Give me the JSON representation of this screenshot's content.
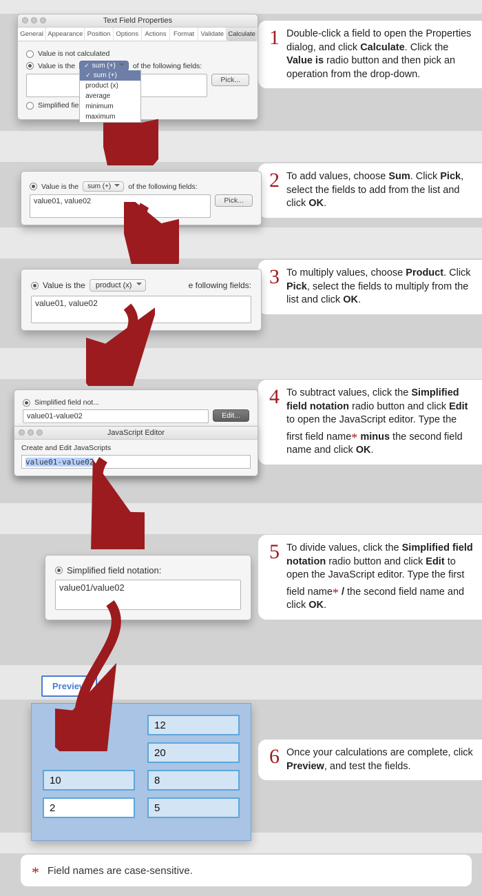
{
  "dialog": {
    "title": "Text Field Properties",
    "tabs": [
      "General",
      "Appearance",
      "Position",
      "Options",
      "Actions",
      "Format",
      "Validate",
      "Calculate"
    ],
    "active_tab": "Calculate",
    "radio_not_calc": "Value is not calculated",
    "value_is_the": "Value is the",
    "of_following": "of the following fields:",
    "simplified_label": "Simplified field notation:",
    "pick": "Pick...",
    "edit": "Edit...",
    "dd_options": [
      "sum (+)",
      "product (x)",
      "average",
      "minimum",
      "maximum"
    ]
  },
  "panel1": {
    "selected_option": "sum (+)"
  },
  "panel2": {
    "selected_option": "sum (+)",
    "fields": "value01, value02"
  },
  "panel3": {
    "selected_option": "product (x)",
    "fields": "value01, value02"
  },
  "panel4": {
    "radio": "Simplified field not...",
    "value": "value01-value02",
    "js_title": "JavaScript Editor",
    "js_label": "Create and Edit JavaScripts",
    "js_code": "value01-value02"
  },
  "panel5": {
    "label": "Simplified field notation:",
    "value": "value01/value02"
  },
  "preview": {
    "btn": "Preview",
    "left": [
      "10",
      "2"
    ],
    "right": [
      "12",
      "20",
      "8",
      "5"
    ]
  },
  "steps": {
    "s1": {
      "n": "1",
      "parts": [
        "Double-click a field to open the Properties dialog, and click ",
        {
          "b": "Calculate"
        },
        ". Click the ",
        {
          "b": "Value is"
        },
        " radio button and then pick an operation from the drop-down."
      ]
    },
    "s2": {
      "n": "2",
      "parts": [
        "To add values, choose ",
        {
          "b": "Sum"
        },
        ". Click ",
        {
          "b": "Pick"
        },
        ", select the fields to add from the list and click ",
        {
          "b": "OK"
        },
        "."
      ]
    },
    "s3": {
      "n": "3",
      "parts": [
        "To multiply values, choose ",
        {
          "b": "Product"
        },
        ". Click ",
        {
          "b": "Pick"
        },
        ", select the fields to multiply from the list and click ",
        {
          "b": "OK"
        },
        "."
      ]
    },
    "s4": {
      "n": "4",
      "parts": [
        "To subtract values, click the ",
        {
          "b": "Simplified field notation"
        },
        " radio button and click ",
        {
          "b": "Edit"
        },
        " to open the JavaScript editor. Type the first field name",
        {
          "ast": "*"
        },
        " ",
        {
          "b": "minus"
        },
        " the second field name and click ",
        {
          "b": "OK"
        },
        "."
      ]
    },
    "s5": {
      "n": "5",
      "parts": [
        "To divide values, click the ",
        {
          "b": "Simplified field notation"
        },
        " radio button and click ",
        {
          "b": "Edit"
        },
        " to open the JavaScript editor. Type the first field name",
        {
          "ast": "*"
        },
        " ",
        {
          "b": "/"
        },
        " the second field name and click ",
        {
          "b": "OK"
        },
        "."
      ]
    },
    "s6": {
      "n": "6",
      "parts": [
        "Once your calculations are complete, click ",
        {
          "b": "Preview"
        },
        ", and test the fields."
      ]
    }
  },
  "footnote": "Field names are case-sensitive."
}
